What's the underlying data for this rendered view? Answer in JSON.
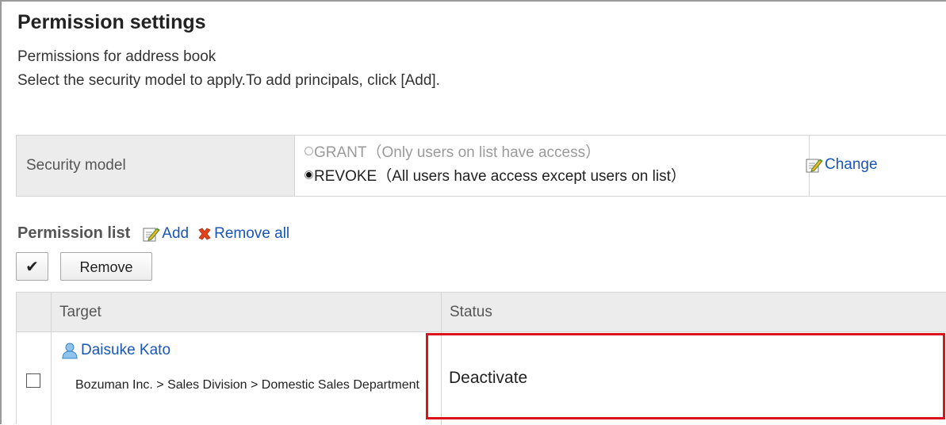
{
  "page": {
    "title": "Permission settings",
    "description_line1": "Permissions for address book",
    "description_line2": "Select the security model to apply.To add principals, click [Add]."
  },
  "security_model": {
    "label": "Security model",
    "options": [
      {
        "label": "GRANT（Only users on list have access）",
        "selected": false,
        "disabled": true
      },
      {
        "label": "REVOKE（All users have access except users on list）",
        "selected": true,
        "disabled": false
      }
    ],
    "change_label": "Change"
  },
  "permission_list": {
    "title": "Permission list",
    "add_label": "Add",
    "remove_all_label": "Remove all",
    "check_all_label": "✔",
    "remove_label": "Remove",
    "columns": [
      "Target",
      "Status"
    ],
    "rows": [
      {
        "name": "Daisuke Kato",
        "path": "Bozuman Inc. > Sales Division > Domestic Sales Department",
        "status": "Deactivate",
        "checked": false
      }
    ]
  },
  "colors": {
    "link": "#1a55b8",
    "highlight": "#d9141c",
    "header_bg": "#ececec"
  },
  "icons": [
    "edit-icon",
    "remove-icon",
    "user-icon"
  ]
}
